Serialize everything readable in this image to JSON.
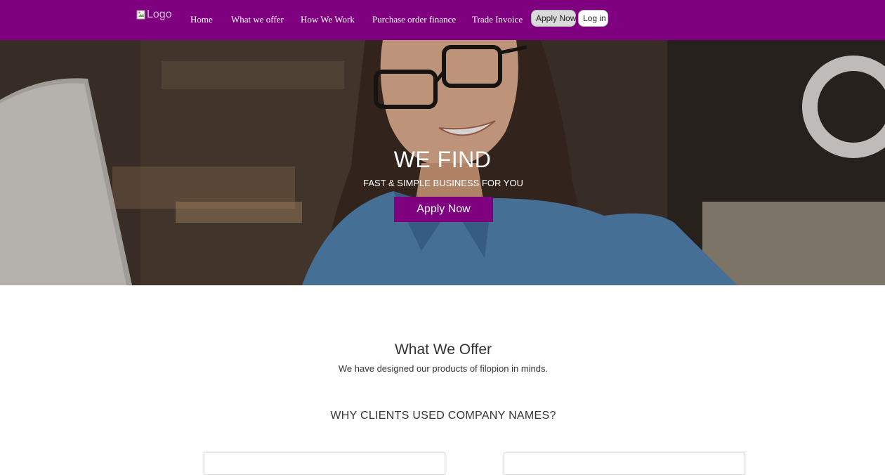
{
  "navbar": {
    "logo_alt": "Logo",
    "links": [
      {
        "label": "Home"
      },
      {
        "label": "What we offer"
      },
      {
        "label": "How We Work"
      },
      {
        "label": "Purchase order finance"
      },
      {
        "label": "Trade Invoice"
      }
    ],
    "apply_label": "Apply Now",
    "login_label": "Log in",
    "background_color": "#7f0180"
  },
  "hero": {
    "title": "WE FIND",
    "subtitle": "FAST & SIMPLE BUSINESS FOR YOU",
    "cta_label": "Apply Now",
    "accent_color": "#7f0180"
  },
  "offer": {
    "title": "What We Offer",
    "subtitle": "We have designed our products of filopion in minds.",
    "why_heading": "WHY CLIENTS USED COMPANY NAMES?"
  }
}
